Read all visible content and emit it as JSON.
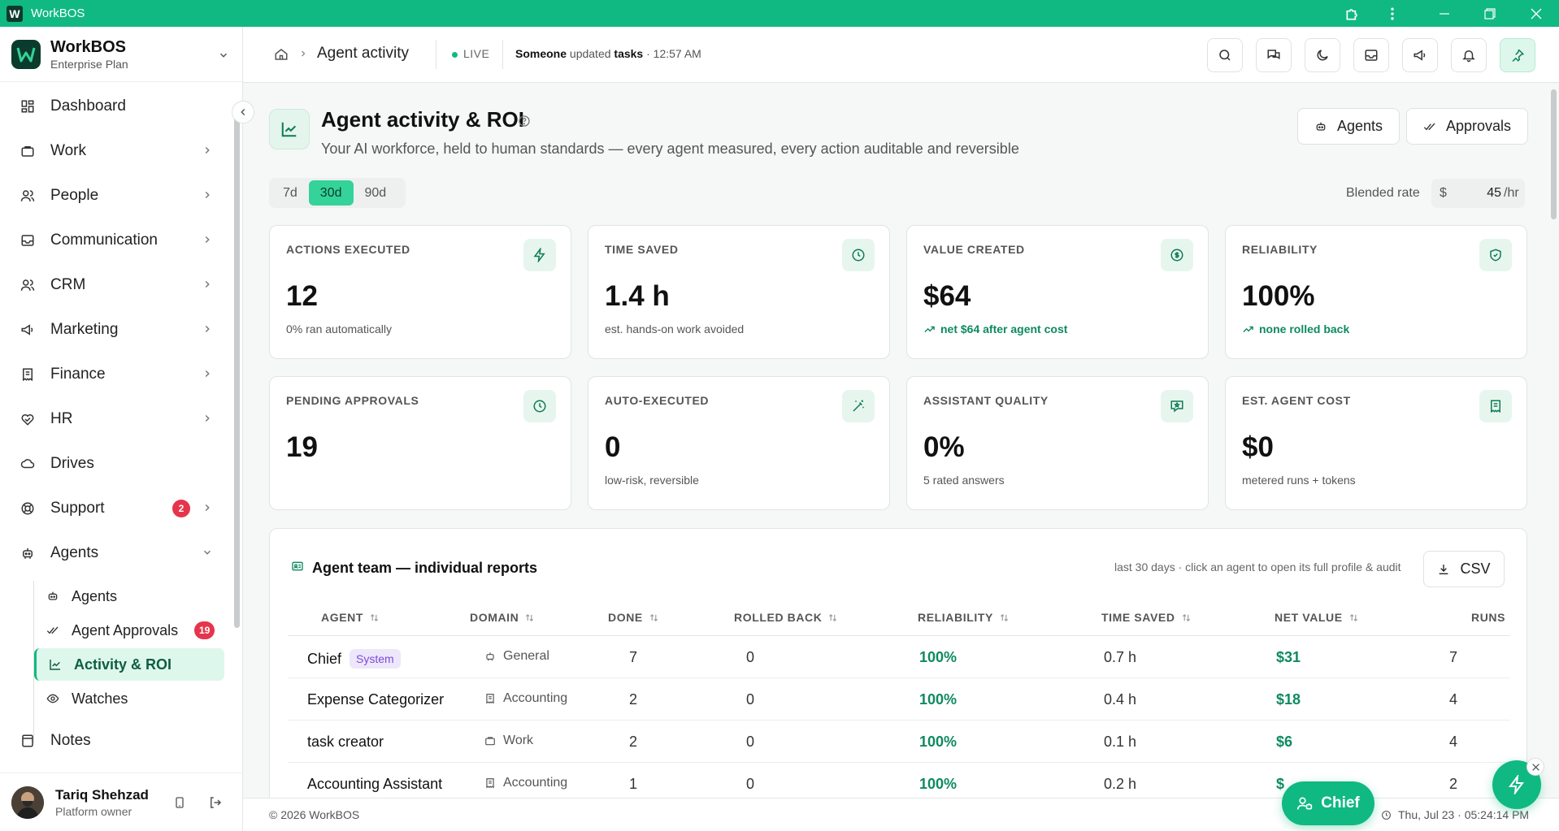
{
  "window": {
    "title": "WorkBOS"
  },
  "brand": {
    "name": "WorkBOS",
    "plan": "Enterprise Plan"
  },
  "sidebar": {
    "items": [
      {
        "label": "Dashboard",
        "icon": "dashboard-icon"
      },
      {
        "label": "Work",
        "icon": "briefcase-icon"
      },
      {
        "label": "People",
        "icon": "users-icon"
      },
      {
        "label": "Communication",
        "icon": "inbox-icon"
      },
      {
        "label": "CRM",
        "icon": "users-icon"
      },
      {
        "label": "Marketing",
        "icon": "megaphone-icon"
      },
      {
        "label": "Finance",
        "icon": "receipt-icon"
      },
      {
        "label": "HR",
        "icon": "heart-handshake-icon"
      },
      {
        "label": "Drives",
        "icon": "cloud-icon"
      },
      {
        "label": "Support",
        "icon": "lifebuoy-icon",
        "badge": "2"
      },
      {
        "label": "Agents",
        "icon": "bot-icon"
      }
    ],
    "agents_sub": [
      {
        "label": "Agents",
        "icon": "bot-icon"
      },
      {
        "label": "Agent Approvals",
        "icon": "check-check-icon",
        "badge": "19"
      },
      {
        "label": "Activity & ROI",
        "icon": "chart-line-icon"
      },
      {
        "label": "Watches",
        "icon": "eye-icon"
      }
    ],
    "notes": "Notes"
  },
  "user": {
    "name": "Tariq Shehzad",
    "role": "Platform owner"
  },
  "topbar": {
    "breadcrumb": "Agent activity",
    "live": "LIVE",
    "activity_actor": "Someone",
    "activity_verb": "updated",
    "activity_object": "tasks",
    "activity_time": "· 12:57 AM"
  },
  "page": {
    "title": "Agent activity & ROI",
    "subtitle": "Your AI workforce, held to human standards — every agent measured, every action auditable and reversible",
    "agents_btn": "Agents",
    "approvals_btn": "Approvals",
    "periods": [
      "7d",
      "30d",
      "90d"
    ],
    "period_active": "30d",
    "rate_label": "Blended rate",
    "rate_currency": "$",
    "rate_value": "45",
    "rate_unit": "/hr"
  },
  "cards": [
    {
      "label": "ACTIONS EXECUTED",
      "value": "12",
      "note": "0% ran automatically",
      "icon": "zap-icon",
      "positive": false
    },
    {
      "label": "TIME SAVED",
      "value": "1.4 h",
      "note": "est. hands-on work avoided",
      "icon": "clock-icon",
      "positive": false
    },
    {
      "label": "VALUE CREATED",
      "value": "$64",
      "note": "net $64 after agent cost",
      "icon": "dollar-circle-icon",
      "positive": true
    },
    {
      "label": "RELIABILITY",
      "value": "100%",
      "note": "none rolled back",
      "icon": "shield-check-icon",
      "positive": true
    },
    {
      "label": "PENDING APPROVALS",
      "value": "19",
      "note": "",
      "icon": "clock-icon",
      "positive": false
    },
    {
      "label": "AUTO-EXECUTED",
      "value": "0",
      "note": "low-risk, reversible",
      "icon": "wand-icon",
      "positive": false
    },
    {
      "label": "ASSISTANT QUALITY",
      "value": "0%",
      "note": "5 rated answers",
      "icon": "message-star-icon",
      "positive": false
    },
    {
      "label": "EST. AGENT COST",
      "value": "$0",
      "note": "metered runs + tokens",
      "icon": "receipt-icon",
      "positive": false
    }
  ],
  "team": {
    "title": "Agent team — individual reports",
    "note": "last 30 days · click an agent to open its full profile & audit",
    "csv": "CSV",
    "columns": [
      "AGENT",
      "DOMAIN",
      "DONE",
      "ROLLED BACK",
      "RELIABILITY",
      "TIME SAVED",
      "NET VALUE",
      "RUNS"
    ],
    "rows": [
      {
        "agent": "Chief",
        "tag": "System",
        "domain": "General",
        "domain_icon": "bot-icon",
        "done": "7",
        "rolled_back": "0",
        "reliability": "100%",
        "time_saved": "0.7 h",
        "net_value": "$31",
        "runs": "7"
      },
      {
        "agent": "Expense Categorizer",
        "tag": "",
        "domain": "Accounting",
        "domain_icon": "receipt-icon",
        "done": "2",
        "rolled_back": "0",
        "reliability": "100%",
        "time_saved": "0.4 h",
        "net_value": "$18",
        "runs": "4"
      },
      {
        "agent": "task creator",
        "tag": "",
        "domain": "Work",
        "domain_icon": "briefcase-icon",
        "done": "2",
        "rolled_back": "0",
        "reliability": "100%",
        "time_saved": "0.1 h",
        "net_value": "$6",
        "runs": "4"
      },
      {
        "agent": "Accounting Assistant",
        "tag": "",
        "domain": "Accounting",
        "domain_icon": "receipt-icon",
        "done": "1",
        "rolled_back": "0",
        "reliability": "100%",
        "time_saved": "0.2 h",
        "net_value": "$",
        "runs": "2"
      }
    ]
  },
  "footer": {
    "copyright": "© 2026 WorkBOS",
    "datetime": "Thu, Jul 23 · 05:24:14 PM"
  },
  "chief_btn": "Chief",
  "colors": {
    "accent": "#10b981",
    "badge": "#e5354c",
    "positive": "#0f8a5f"
  }
}
